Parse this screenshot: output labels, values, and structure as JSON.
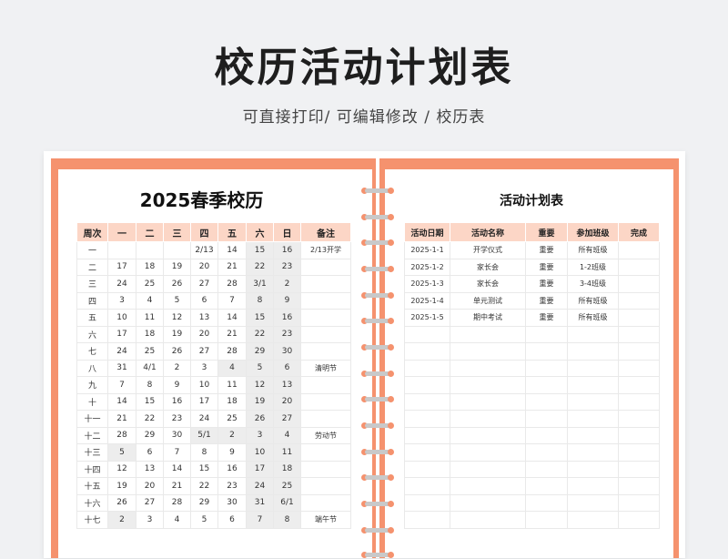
{
  "header": {
    "title": "校历活动计划表",
    "subtitle": "可直接打印/ 可编辑修改 / 校历表"
  },
  "calendar": {
    "title": "2025春季校历",
    "headers": [
      "周次",
      "一",
      "二",
      "三",
      "四",
      "五",
      "六",
      "日",
      "备注"
    ],
    "rows": [
      [
        "一",
        "",
        "",
        "",
        "2/13",
        "14",
        "15",
        "16",
        "2/13开学"
      ],
      [
        "二",
        "17",
        "18",
        "19",
        "20",
        "21",
        "22",
        "23",
        ""
      ],
      [
        "三",
        "24",
        "25",
        "26",
        "27",
        "28",
        "3/1",
        "2",
        ""
      ],
      [
        "四",
        "3",
        "4",
        "5",
        "6",
        "7",
        "8",
        "9",
        ""
      ],
      [
        "五",
        "10",
        "11",
        "12",
        "13",
        "14",
        "15",
        "16",
        ""
      ],
      [
        "六",
        "17",
        "18",
        "19",
        "20",
        "21",
        "22",
        "23",
        ""
      ],
      [
        "七",
        "24",
        "25",
        "26",
        "27",
        "28",
        "29",
        "30",
        ""
      ],
      [
        "八",
        "31",
        "4/1",
        "2",
        "3",
        "4",
        "5",
        "6",
        "清明节"
      ],
      [
        "九",
        "7",
        "8",
        "9",
        "10",
        "11",
        "12",
        "13",
        ""
      ],
      [
        "十",
        "14",
        "15",
        "16",
        "17",
        "18",
        "19",
        "20",
        ""
      ],
      [
        "十一",
        "21",
        "22",
        "23",
        "24",
        "25",
        "26",
        "27",
        ""
      ],
      [
        "十二",
        "28",
        "29",
        "30",
        "5/1",
        "2",
        "3",
        "4",
        "劳动节"
      ],
      [
        "十三",
        "5",
        "6",
        "7",
        "8",
        "9",
        "10",
        "11",
        ""
      ],
      [
        "十四",
        "12",
        "13",
        "14",
        "15",
        "16",
        "17",
        "18",
        ""
      ],
      [
        "十五",
        "19",
        "20",
        "21",
        "22",
        "23",
        "24",
        "25",
        ""
      ],
      [
        "十六",
        "26",
        "27",
        "28",
        "29",
        "30",
        "31",
        "6/1",
        ""
      ],
      [
        "十七",
        "2",
        "3",
        "4",
        "5",
        "6",
        "7",
        "8",
        "端午节"
      ]
    ],
    "shaded": [
      [
        1,
        6
      ],
      [
        1,
        7
      ],
      [
        2,
        6
      ],
      [
        2,
        7
      ],
      [
        3,
        6
      ],
      [
        3,
        7
      ],
      [
        4,
        6
      ],
      [
        4,
        7
      ],
      [
        5,
        6
      ],
      [
        5,
        7
      ],
      [
        6,
        6
      ],
      [
        6,
        7
      ],
      [
        7,
        6
      ],
      [
        7,
        7
      ],
      [
        8,
        5
      ],
      [
        8,
        6
      ],
      [
        8,
        7
      ],
      [
        9,
        6
      ],
      [
        9,
        7
      ],
      [
        10,
        6
      ],
      [
        10,
        7
      ],
      [
        11,
        6
      ],
      [
        11,
        7
      ],
      [
        12,
        4
      ],
      [
        12,
        5
      ],
      [
        12,
        6
      ],
      [
        12,
        7
      ],
      [
        13,
        1
      ],
      [
        13,
        6
      ],
      [
        13,
        7
      ],
      [
        14,
        6
      ],
      [
        14,
        7
      ],
      [
        15,
        6
      ],
      [
        15,
        7
      ],
      [
        16,
        6
      ],
      [
        16,
        7
      ],
      [
        17,
        1
      ],
      [
        17,
        6
      ],
      [
        17,
        7
      ]
    ]
  },
  "plan": {
    "title": "活动计划表",
    "headers": [
      "活动日期",
      "活动名称",
      "重要",
      "参加班级",
      "完成"
    ],
    "rows": [
      [
        "2025-1-1",
        "开学仪式",
        "重要",
        "所有班级",
        ""
      ],
      [
        "2025-1-2",
        "家长会",
        "重要",
        "1-2班级",
        ""
      ],
      [
        "2025-1-3",
        "家长会",
        "重要",
        "3-4班级",
        ""
      ],
      [
        "2025-1-4",
        "单元测试",
        "重要",
        "所有班级",
        ""
      ],
      [
        "2025-1-5",
        "期中考试",
        "重要",
        "所有班级",
        ""
      ]
    ],
    "empty_rows": 12
  },
  "colors": {
    "binder": "#f5926e",
    "header_fill": "#fcd6c6",
    "weekend_fill": "#ededed",
    "ring": "#c9c9c9"
  }
}
